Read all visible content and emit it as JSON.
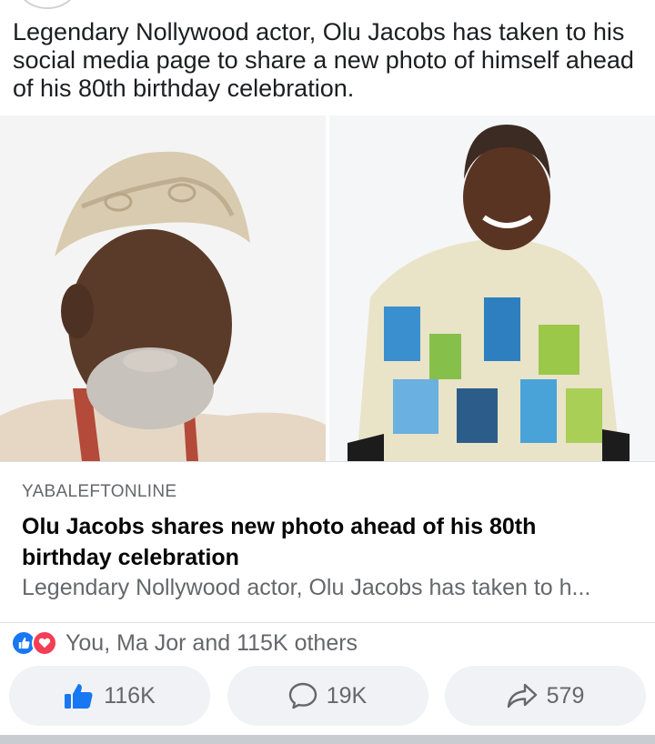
{
  "post": {
    "text": "Legendary Nollywood actor, Olu Jacobs has taken to his social media page to share a new photo of himself ahead of his 80th birthday celebration."
  },
  "link_preview": {
    "source": "YABALEFTONLINE",
    "title": "Olu Jacobs shares new photo ahead of his 80th birthday celebration",
    "description": "Legendary Nollywood actor, Olu Jacobs has taken to h..."
  },
  "reactions": {
    "text": "You, Ma Jor and 115K others",
    "icons": [
      "like-icon",
      "love-icon"
    ]
  },
  "actions": {
    "like_count": "116K",
    "comment_count": "19K",
    "share_count": "579"
  },
  "colors": {
    "like_blue": "#1877f2",
    "love_red": "#f33e58",
    "button_bg": "#f0f2f5",
    "muted_text": "#65676b"
  }
}
